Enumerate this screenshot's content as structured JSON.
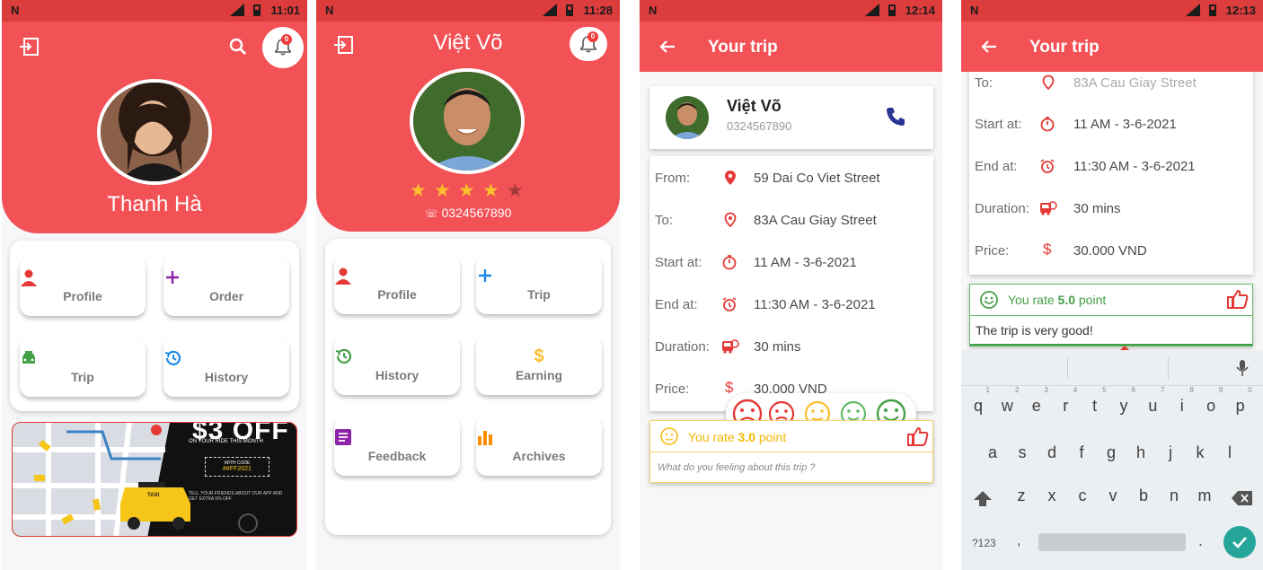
{
  "status": {
    "s1_time": "11:01",
    "s2_time": "11:28",
    "s3_time": "12:14",
    "s4_time": "12:13",
    "carrier_logo": "N",
    "sig_tag": "LTE"
  },
  "screen1": {
    "user_name": "Thanh Hà",
    "notif_count": "0",
    "tiles": [
      {
        "label": "Profile",
        "icon": "person-icon",
        "color": "#e53935"
      },
      {
        "label": "Order",
        "icon": "plus-icon",
        "color": "#8e24aa"
      },
      {
        "label": "Trip",
        "icon": "taxi-icon",
        "color": "#43a047"
      },
      {
        "label": "History",
        "icon": "history-icon",
        "color": "#1e88e5"
      }
    ],
    "promo": {
      "headline": "$3 OFF",
      "line1": "ON YOUR RIDE THIS MONTH",
      "code_label": "WITH CODE",
      "code": "##FF2021",
      "small": "TELL YOUR FRIENDS ABOUT OUR APP AND GET EXTRA 5% OFF",
      "taxi_text": "TAXI"
    }
  },
  "screen2": {
    "driver_name": "Việt Võ",
    "notif_count": "0",
    "rating": 4,
    "rating_max": 5,
    "phone": "0324567890",
    "tiles": [
      {
        "label": "Profile",
        "icon": "person-icon",
        "color": "#e53935"
      },
      {
        "label": "Trip",
        "icon": "plus-icon",
        "color": "#1e88e5"
      },
      {
        "label": "History",
        "icon": "history-icon",
        "color": "#43a047"
      },
      {
        "label": "Earning",
        "icon": "dollar-icon",
        "color": "#fbc02d"
      },
      {
        "label": "Feedback",
        "icon": "feedback-icon",
        "color": "#8e24aa"
      },
      {
        "label": "Archives",
        "icon": "bar-chart-icon",
        "color": "#fb8c00"
      }
    ]
  },
  "screen3": {
    "title": "Your trip",
    "driver_name": "Việt Võ",
    "driver_phone": "0324567890",
    "rows": [
      {
        "label": "From:",
        "icon": "pin-icon",
        "value": "59 Dai Co Viet Street"
      },
      {
        "label": "To:",
        "icon": "pin-outline-icon",
        "value": "83A Cau Giay Street"
      },
      {
        "label": "Start at:",
        "icon": "stopwatch-icon",
        "value": "11 AM - 3-6-2021"
      },
      {
        "label": "End at:",
        "icon": "alarm-icon",
        "value": "11:30 AM - 3-6-2021"
      },
      {
        "label": "Duration:",
        "icon": "bus-icon",
        "value": "30 mins"
      },
      {
        "label": "Price:",
        "icon": "dollar-icon",
        "value": "30.000 VND"
      }
    ],
    "rate_prefix": "You rate",
    "rate_value": "3.0",
    "rate_suffix": "point",
    "feedback_placeholder": "What do you feeling about this trip ?",
    "emoji_colors": [
      "#e53935",
      "#e53935",
      "#fbc02d",
      "#66bb6a",
      "#43a047"
    ]
  },
  "screen4": {
    "title": "Your trip",
    "rows": [
      {
        "label": "To:",
        "icon": "pin-outline-icon",
        "value": "83A Cau Giay Street"
      },
      {
        "label": "Start at:",
        "icon": "stopwatch-icon",
        "value": "11 AM - 3-6-2021"
      },
      {
        "label": "End at:",
        "icon": "alarm-icon",
        "value": "11:30 AM - 3-6-2021"
      },
      {
        "label": "Duration:",
        "icon": "bus-icon",
        "value": "30 mins"
      },
      {
        "label": "Price:",
        "icon": "dollar-icon",
        "value": "30.000 VND"
      }
    ],
    "rate_prefix": "You rate",
    "rate_value": "5.0",
    "rate_suffix": "point",
    "feedback_text": "The trip is very good!",
    "keyboard": {
      "row1": [
        "q",
        "w",
        "e",
        "r",
        "t",
        "y",
        "u",
        "i",
        "o",
        "p"
      ],
      "row1_nums": [
        "1",
        "2",
        "3",
        "4",
        "5",
        "6",
        "7",
        "8",
        "9",
        "0"
      ],
      "row2": [
        "a",
        "s",
        "d",
        "f",
        "g",
        "h",
        "j",
        "k",
        "l"
      ],
      "row3": [
        "z",
        "x",
        "c",
        "v",
        "b",
        "n",
        "m"
      ],
      "sym_key": "?123",
      "comma": ",",
      "period": "."
    }
  },
  "colors": {
    "primary_red": "#f25155",
    "status_red": "#dd3c3c",
    "green_rate": "#43a047",
    "yellow_rate": "#fbc02d"
  }
}
